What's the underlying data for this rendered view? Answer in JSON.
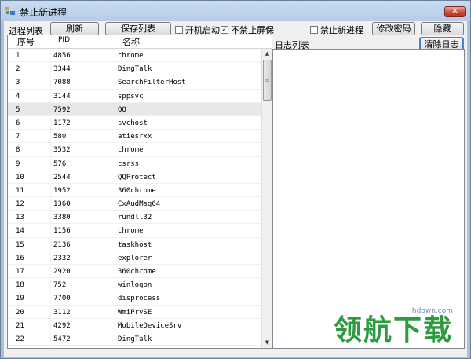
{
  "window": {
    "title": "禁止新进程",
    "close_glyph": "✕"
  },
  "toolbar": {
    "process_list_label": "进程列表",
    "refresh_label": "刷新",
    "save_list_label": "保存列表",
    "autostart_label": "开机启动",
    "autostart_checked": false,
    "no_block_screen_label": "不禁止屏保",
    "no_block_screen_checked": true,
    "block_new_process_label": "禁止新进程",
    "block_new_process_checked": false,
    "change_password_label": "修改密码",
    "hide_label": "隐藏"
  },
  "list": {
    "columns": [
      "序号",
      "PID",
      "名称"
    ],
    "rows": [
      [
        "1",
        "4856",
        "chrome"
      ],
      [
        "2",
        "3344",
        "DingTalk"
      ],
      [
        "3",
        "7088",
        "SearchFilterHost"
      ],
      [
        "4",
        "3144",
        "sppsvc"
      ],
      [
        "5",
        "7592",
        "QQ"
      ],
      [
        "6",
        "1172",
        "svchost"
      ],
      [
        "7",
        "580",
        "atiesrxx"
      ],
      [
        "8",
        "3532",
        "chrome"
      ],
      [
        "9",
        "576",
        "csrss"
      ],
      [
        "10",
        "2544",
        "QQProtect"
      ],
      [
        "11",
        "1952",
        "360chrome"
      ],
      [
        "12",
        "1360",
        "CxAudMsg64"
      ],
      [
        "13",
        "3380",
        "rundll32"
      ],
      [
        "14",
        "1156",
        "chrome"
      ],
      [
        "15",
        "2136",
        "taskhost"
      ],
      [
        "16",
        "2332",
        "explorer"
      ],
      [
        "17",
        "2920",
        "360chrome"
      ],
      [
        "18",
        "752",
        "winlogon"
      ],
      [
        "19",
        "7700",
        "disprocess"
      ],
      [
        "20",
        "3112",
        "WmiPrvSE"
      ],
      [
        "21",
        "4292",
        "MobileDeviceSrv"
      ],
      [
        "22",
        "5472",
        "DingTalk"
      ]
    ],
    "selected_row": 5
  },
  "log": {
    "label": "日志列表",
    "clear_label": "清除日志"
  },
  "watermark": {
    "site": "lhdown.com",
    "text": "领航下载"
  }
}
